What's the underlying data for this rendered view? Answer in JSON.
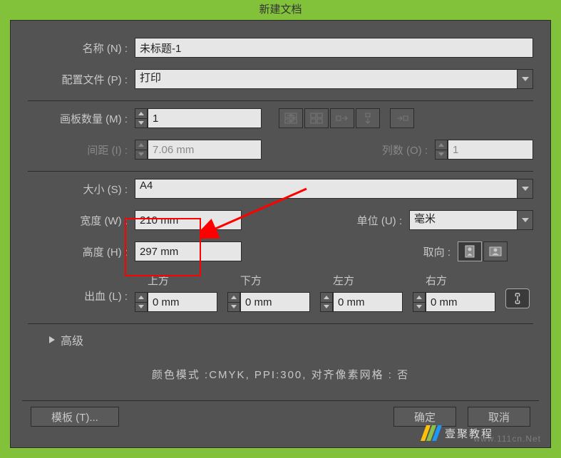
{
  "dialog": {
    "title": "新建文档"
  },
  "fields": {
    "name_label": "名称 (N) :",
    "name_value": "未标题-1",
    "profile_label": "配置文件 (P) :",
    "profile_value": "打印",
    "artboards_label": "画板数量 (M) :",
    "artboards_value": "1",
    "spacing_label": "间距 (I) :",
    "spacing_value": "7.06 mm",
    "columns_label": "列数 (O) :",
    "columns_value": "1",
    "size_label": "大小 (S) :",
    "size_value": "A4",
    "width_label": "宽度 (W) :",
    "width_value": "210 mm",
    "units_label": "单位 (U) :",
    "units_value": "毫米",
    "height_label": "高度 (H) :",
    "height_value": "297 mm",
    "orientation_label": "取向 :",
    "bleed_label": "出血 (L) :",
    "bleed_top": "上方",
    "bleed_bottom": "下方",
    "bleed_left": "左方",
    "bleed_right": "右方",
    "bleed_value": "0 mm",
    "advanced_label": "高级",
    "info_text": "颜色模式 :CMYK, PPI:300, 对齐像素网格 : 否"
  },
  "buttons": {
    "template": "模板 (T)...",
    "ok": "确定",
    "cancel": "取消"
  },
  "watermark": {
    "text": "壹聚教程",
    "url": "www.111cn.Net"
  }
}
